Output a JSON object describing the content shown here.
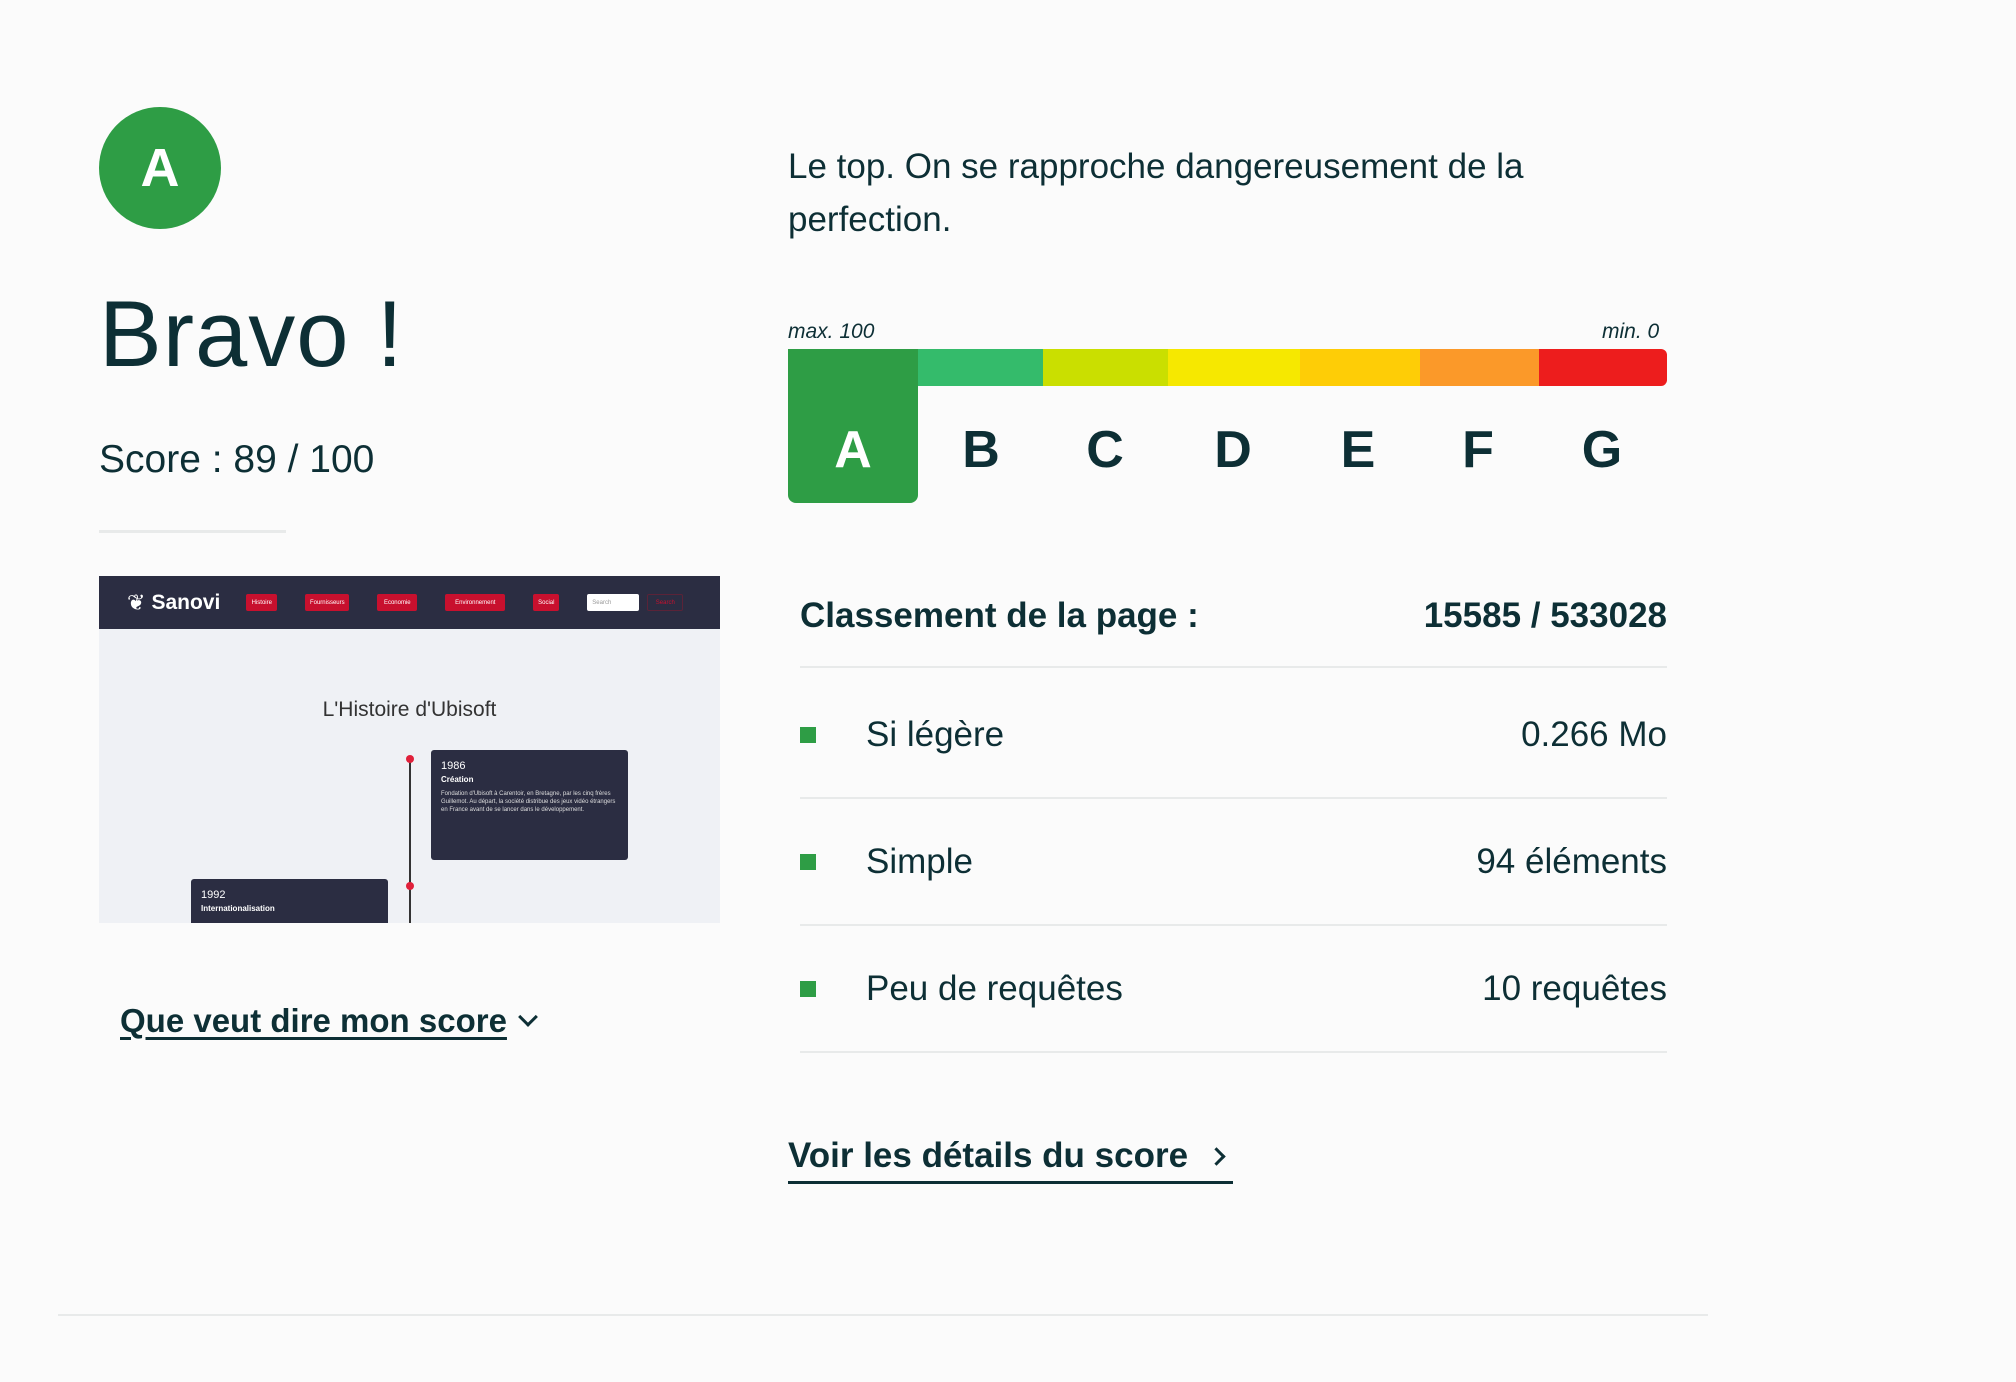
{
  "grade": {
    "letter": "A",
    "color": "#2e9d45"
  },
  "headline": "Bravo !",
  "score": {
    "label": "Score :",
    "value": "89 / 100"
  },
  "thumbnail": {
    "logo": "Sanovi",
    "nav_items": [
      "Histoire",
      "Fournisseurs",
      "Economie",
      "Environnement",
      "Social"
    ],
    "search_placeholder": "Search",
    "search_button": "Search",
    "title": "L'Histoire d'Ubisoft",
    "cards": [
      {
        "year": "1986",
        "title": "Création",
        "text": "Fondation d'Ubisoft à Carentoir, en Bretagne, par les cinq frères Guillemot. Au départ, la société distribue des jeux vidéo étrangers en France avant de se lancer dans le développement."
      },
      {
        "year": "1992",
        "title": "Internationalisation",
        "text": ""
      }
    ]
  },
  "score_link": "Que veut dire mon score",
  "description": "Le top. On se rapproche dangereusement de la perfection.",
  "scale": {
    "max_label": "max. 100",
    "min_label": "min. 0",
    "grades": [
      {
        "letter": "A",
        "color": "#2e9d45"
      },
      {
        "letter": "B",
        "color": "#34bb6b"
      },
      {
        "letter": "C",
        "color": "#cadf00"
      },
      {
        "letter": "D",
        "color": "#f6e800"
      },
      {
        "letter": "E",
        "color": "#fecd06"
      },
      {
        "letter": "F",
        "color": "#fb9929"
      },
      {
        "letter": "G",
        "color": "#ed1d1d"
      }
    ],
    "active": "A"
  },
  "ranking": {
    "label": "Classement de la page :",
    "value": "15585 / 533028"
  },
  "metrics": [
    {
      "label": "Si légère",
      "value": "0.266 Mo"
    },
    {
      "label": "Simple",
      "value": "94 éléments"
    },
    {
      "label": "Peu de requêtes",
      "value": "10 requêtes"
    }
  ],
  "details_link": "Voir les détails du score"
}
